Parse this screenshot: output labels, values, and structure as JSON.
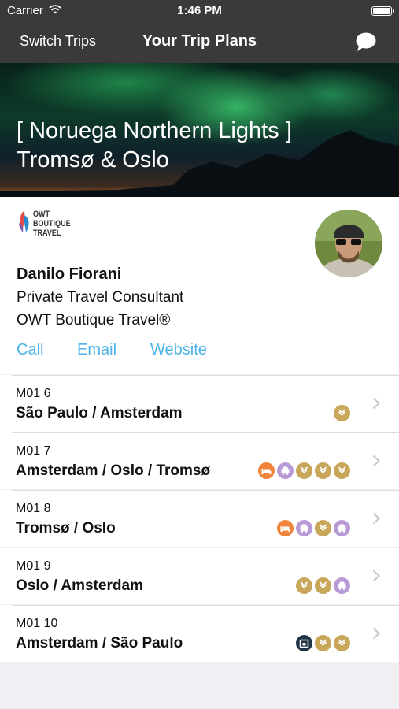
{
  "status_bar": {
    "carrier": "Carrier",
    "time": "1:46 PM"
  },
  "nav": {
    "switch_label": "Switch Trips",
    "title": "Your Trip Plans",
    "chat_icon": "chat-bubble-icon"
  },
  "hero": {
    "line1": "[ Noruega Northern Lights ]",
    "line2": "Tromsø & Oslo"
  },
  "agent": {
    "logo_lines": [
      "OWT",
      "BOUTIQUE",
      "TRAVEL"
    ],
    "name": "Danilo Fiorani",
    "role": "Private Travel Consultant",
    "company": "OWT Boutique Travel®",
    "links": {
      "call": "Call",
      "email": "Email",
      "website": "Website"
    }
  },
  "segments": [
    {
      "code": "M01 6",
      "route": "São Paulo / Amsterdam",
      "icons": [
        "flight"
      ]
    },
    {
      "code": "M01 7",
      "route": "Amsterdam / Oslo / Tromsø",
      "icons": [
        "hotel",
        "car",
        "flight",
        "flight",
        "flight"
      ]
    },
    {
      "code": "M01 8",
      "route": "Tromsø / Oslo",
      "icons": [
        "hotel",
        "car",
        "flight",
        "car"
      ]
    },
    {
      "code": "M01 9",
      "route": "Oslo / Amsterdam",
      "icons": [
        "flight",
        "flight",
        "car"
      ]
    },
    {
      "code": "M01 10",
      "route": "Amsterdam / São Paulo",
      "icons": [
        "event",
        "flight",
        "flight"
      ]
    }
  ],
  "colors": {
    "nav_bg": "#3a3a3a",
    "link": "#4bb3e8",
    "flight": "#c8a65a",
    "car": "#b89ad6",
    "hotel": "#f0843a",
    "event": "#1f3547"
  }
}
